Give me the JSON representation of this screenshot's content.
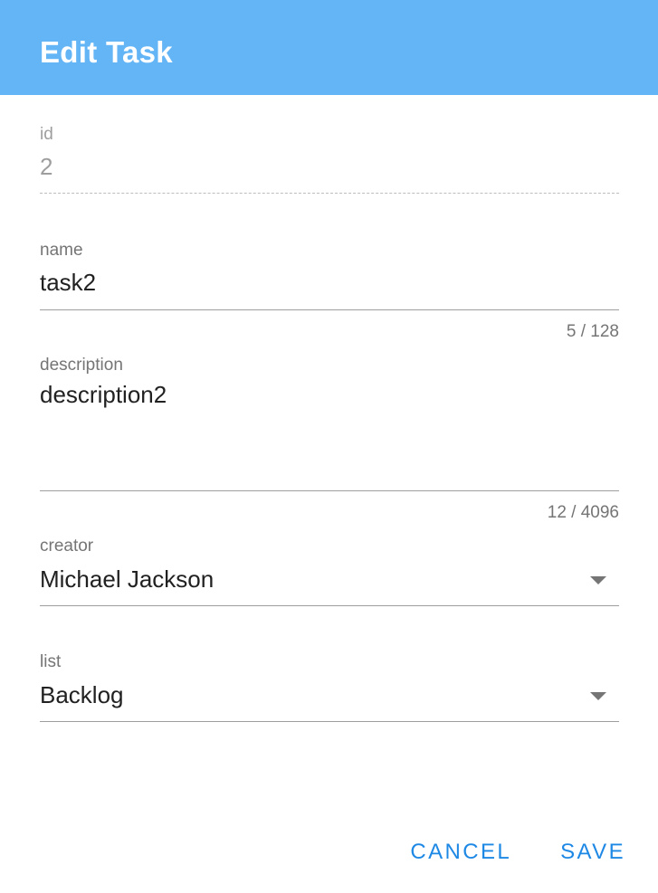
{
  "dialog": {
    "title": "Edit Task",
    "header_color": "#64b5f6"
  },
  "fields": {
    "id": {
      "label": "id",
      "value": "2",
      "disabled": true
    },
    "name": {
      "label": "name",
      "value": "task2",
      "counter": "5 / 128"
    },
    "description": {
      "label": "description",
      "value": "description2",
      "counter": "12 / 4096"
    },
    "creator": {
      "label": "creator",
      "value": "Michael Jackson"
    },
    "list": {
      "label": "list",
      "value": "Backlog"
    }
  },
  "actions": {
    "cancel_label": "CANCEL",
    "save_label": "SAVE",
    "accent_color": "#1e88e5"
  },
  "icons": {
    "dropdown": "chevron-down-icon"
  }
}
